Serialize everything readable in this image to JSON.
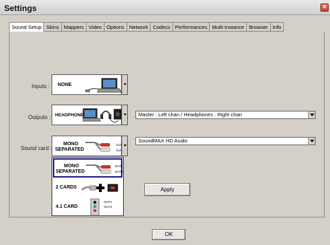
{
  "window": {
    "title": "Settings"
  },
  "tabs": [
    "Sound Setup",
    "Skins",
    "Mappers",
    "Video",
    "Options",
    "Network",
    "Codecs",
    "Performances",
    "Multi-Instance",
    "Browser",
    "Info"
  ],
  "active_tab": "Sound Setup",
  "inputs": {
    "label": "Inputs :",
    "value": "NONE"
  },
  "outputs": {
    "label": "Outputs :",
    "value": "HEADPHONES",
    "mode": "Master : Left chan / Headphones : Right chan"
  },
  "sound_card": {
    "label": "Sound card :",
    "value_line1": "MONO",
    "value_line2": "SEPARATED",
    "device": "SoundMAX HD Audio",
    "out1": "OUT1",
    "out2": "OUT2"
  },
  "sound_card_options": [
    {
      "line1": "MONO",
      "line2": "SEPARATED",
      "out1": "OUT1",
      "out2": "OUT2",
      "selected": true
    },
    {
      "line1": "2 CARDS",
      "line2": "",
      "selected": false
    },
    {
      "line1": "4.1 CARD",
      "line2": "",
      "out1": "OUT1",
      "out2": "OUT2",
      "selected": false
    }
  ],
  "buttons": {
    "apply": "Apply",
    "ok": "OK",
    "close": "×"
  },
  "colors": {
    "selection_border": "#1a1a8a",
    "close_red": "#c8412c"
  }
}
